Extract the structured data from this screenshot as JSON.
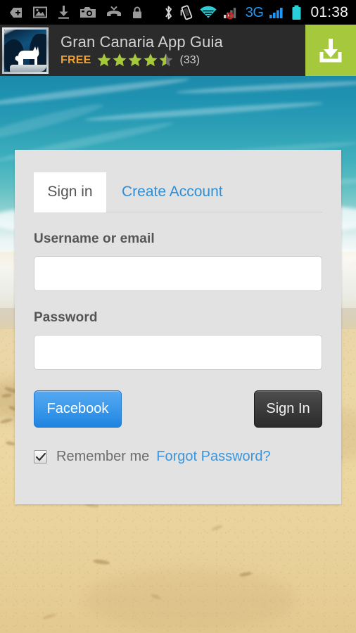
{
  "status_bar": {
    "clock": "01:38",
    "network_label": "3G",
    "left_icons": [
      "add-tag-icon",
      "gallery-image-icon",
      "download-icon",
      "camera-icon",
      "missed-call-icon",
      "lock-icon"
    ],
    "right_icons": [
      "bluetooth-icon",
      "vibrate-icon",
      "wifi-icon",
      "signal-no-service-icon",
      "signal-bars-icon",
      "battery-icon"
    ],
    "colors": {
      "background": "#000000",
      "icon": "#9a9a9a",
      "accent_cyan": "#29d0d8",
      "accent_blue": "#2196f3",
      "no_service_red": "#cc2222",
      "clock_text": "#f2f2f2"
    }
  },
  "ad_banner": {
    "app_icon_name": "gran-canaria-app-icon",
    "title": "Gran Canaria App Guia",
    "price_label": "FREE",
    "rating": 4.5,
    "rating_count_label": "(33)",
    "download_icon_name": "download-icon",
    "colors": {
      "background": "#2b2b2b",
      "title_text": "#d2d2d2",
      "free_text": "#f0a030",
      "star_filled": "#a5c83c",
      "star_empty": "#6e6e6e",
      "download_button": "#a5c83c"
    }
  },
  "login_card": {
    "tabs": [
      {
        "label": "Sign in",
        "active": true
      },
      {
        "label": "Create Account",
        "active": false
      }
    ],
    "username_field": {
      "label": "Username or email",
      "value": "",
      "placeholder": ""
    },
    "password_field": {
      "label": "Password",
      "value": "",
      "placeholder": ""
    },
    "facebook_button_label": "Facebook",
    "signin_button_label": "Sign In",
    "remember_me": {
      "label": "Remember me",
      "checked": true
    },
    "forgot_password_label": "Forgot Password?",
    "colors": {
      "card_background": "#e2e2e2",
      "active_tab_background": "#ffffff",
      "link_blue": "#2f8ed6",
      "label_text": "#555555",
      "facebook_blue": "#3f9cec",
      "signin_dark": "#3d3d3d"
    }
  },
  "background": {
    "scene": "beach-photo",
    "water_color": "#2da0b6",
    "foam_color": "#f2f5f3",
    "sand_color": "#e9d6a8"
  }
}
